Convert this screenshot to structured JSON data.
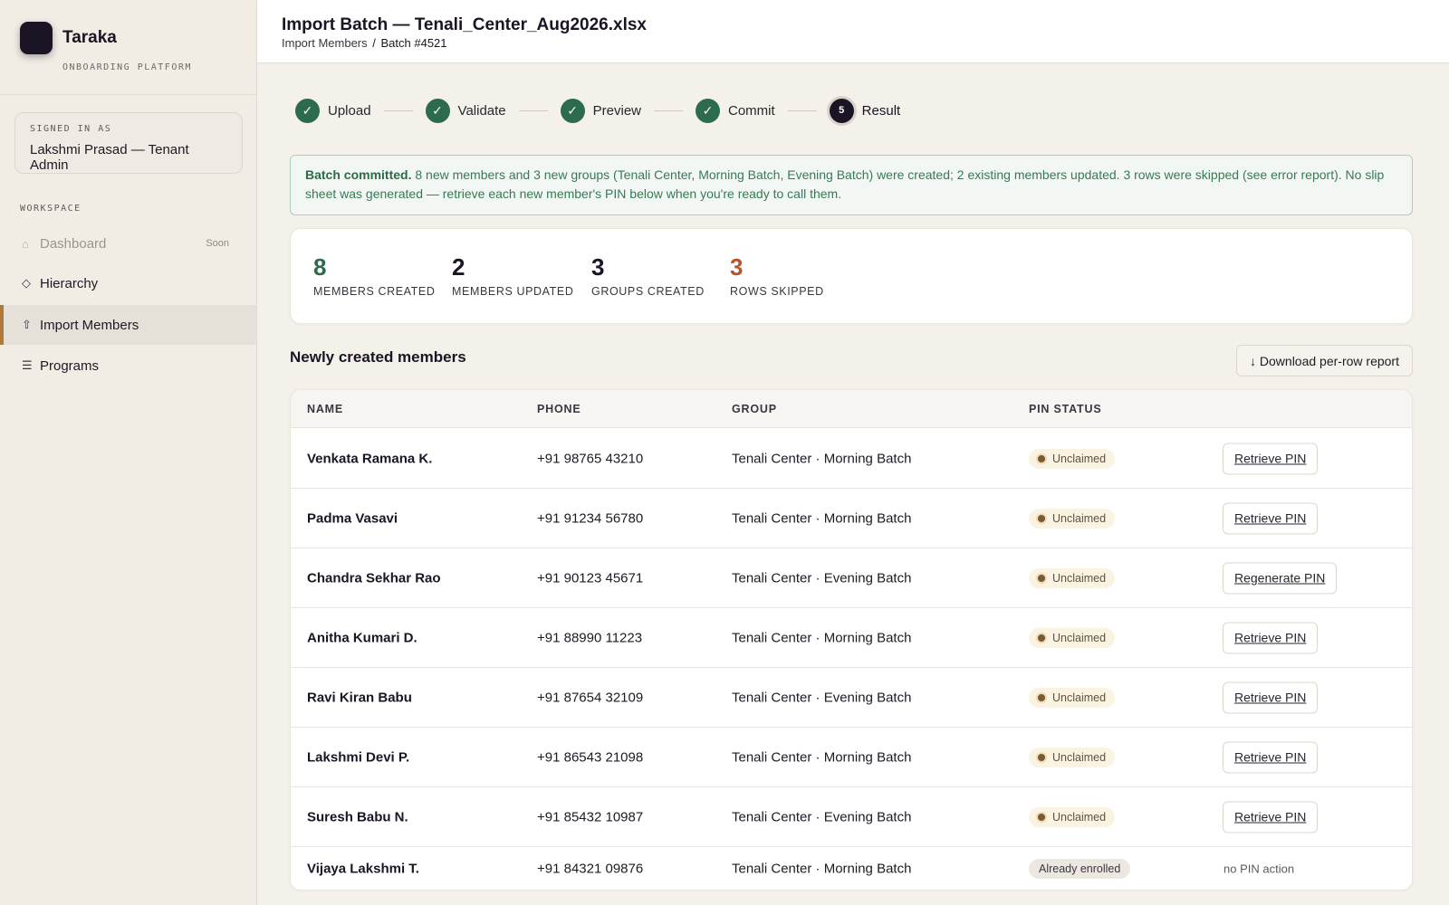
{
  "brand": {
    "name": "Taraka",
    "subtitle": "ONBOARDING PLATFORM"
  },
  "signed_in": {
    "label": "SIGNED IN AS",
    "user": "Lakshmi Prasad — Tenant Admin"
  },
  "sidebar": {
    "section_label": "WORKSPACE",
    "items": [
      {
        "label": "Dashboard",
        "icon": "home-icon",
        "glyph": "⌂",
        "badge": "Soon",
        "state": "disabled"
      },
      {
        "label": "Hierarchy",
        "icon": "diamond-icon",
        "glyph": "◇",
        "state": "normal"
      },
      {
        "label": "Import Members",
        "icon": "upload-arrow-icon",
        "glyph": "⇧",
        "state": "active"
      },
      {
        "label": "Programs",
        "icon": "list-icon",
        "glyph": "☰",
        "state": "normal"
      }
    ]
  },
  "header": {
    "title": "Import Batch — Tenali_Center_Aug2026.xlsx",
    "breadcrumb": {
      "parent": "Import Members",
      "separator": "/",
      "current": "Batch #4521"
    }
  },
  "stepper": {
    "steps": [
      {
        "label": "Upload",
        "state": "done",
        "glyph": "✓"
      },
      {
        "label": "Validate",
        "state": "done",
        "glyph": "✓"
      },
      {
        "label": "Preview",
        "state": "done",
        "glyph": "✓"
      },
      {
        "label": "Commit",
        "state": "done",
        "glyph": "✓"
      },
      {
        "label": "Result",
        "state": "current",
        "glyph": "5"
      }
    ]
  },
  "banner": {
    "bold": "Batch committed.",
    "text": " 8 new members and 3 new groups (Tenali Center, Morning Batch, Evening Batch) were created; 2 existing members updated. 3 rows were skipped (see error report). No slip sheet was generated — retrieve each new member's PIN below when you're ready to call them."
  },
  "stats": [
    {
      "value": "8",
      "label": "MEMBERS CREATED",
      "color": "#2d6b4f"
    },
    {
      "value": "2",
      "label": "MEMBERS UPDATED",
      "color": "#1b1424"
    },
    {
      "value": "3",
      "label": "GROUPS CREATED",
      "color": "#1b1424"
    },
    {
      "value": "3",
      "label": "ROWS SKIPPED",
      "color": "#b5562a"
    }
  ],
  "members_section": {
    "title": "Newly created members",
    "download_label": "↓ Download per-row report"
  },
  "table": {
    "columns": [
      "NAME",
      "PHONE",
      "GROUP",
      "PIN STATUS"
    ],
    "rows": [
      {
        "name": "Venkata Ramana K.",
        "phone": "+91 98765 43210",
        "group": "Tenali Center · Morning Batch",
        "status": "Unclaimed",
        "action": "Retrieve PIN"
      },
      {
        "name": "Padma Vasavi",
        "phone": "+91 91234 56780",
        "group": "Tenali Center · Morning Batch",
        "status": "Unclaimed",
        "action": "Retrieve PIN"
      },
      {
        "name": "Chandra Sekhar Rao",
        "phone": "+91 90123 45671",
        "group": "Tenali Center · Evening Batch",
        "status": "Unclaimed",
        "action": "Regenerate PIN"
      },
      {
        "name": "Anitha Kumari D.",
        "phone": "+91 88990 11223",
        "group": "Tenali Center · Morning Batch",
        "status": "Unclaimed",
        "action": "Retrieve PIN"
      },
      {
        "name": "Ravi Kiran Babu",
        "phone": "+91 87654 32109",
        "group": "Tenali Center · Evening Batch",
        "status": "Unclaimed",
        "action": "Retrieve PIN"
      },
      {
        "name": "Lakshmi Devi P.",
        "phone": "+91 86543 21098",
        "group": "Tenali Center · Morning Batch",
        "status": "Unclaimed",
        "action": "Retrieve PIN"
      },
      {
        "name": "Suresh Babu N.",
        "phone": "+91 85432 10987",
        "group": "Tenali Center · Evening Batch",
        "status": "Unclaimed",
        "action": "Retrieve PIN"
      },
      {
        "name": "Vijaya Lakshmi T.",
        "phone": "+91 84321 09876",
        "group": "Tenali Center · Morning Batch",
        "status": "Already enrolled",
        "action": "no PIN action"
      }
    ]
  }
}
